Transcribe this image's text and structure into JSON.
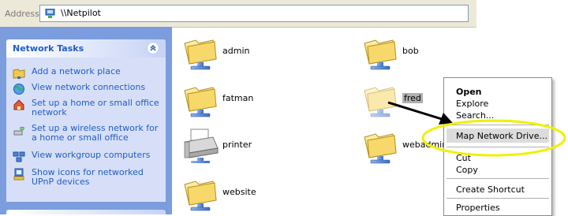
{
  "address_bar": {
    "label": "Address",
    "value": "\\\\Netpilot",
    "icon": "network-computer-icon"
  },
  "task_pane": {
    "title": "Network Tasks",
    "collapse_icon": "double-chevron-up-icon",
    "tasks": [
      {
        "label": "Add a network place",
        "icon": "network-place-icon"
      },
      {
        "label": "View network connections",
        "icon": "globe-icon"
      },
      {
        "label": "Set up a home or small office network",
        "icon": "home-network-icon"
      },
      {
        "label": "Set up a wireless network for a home or small office",
        "icon": "wireless-icon"
      },
      {
        "label": "View workgroup computers",
        "icon": "workgroup-icon"
      },
      {
        "label": "Show icons for networked UPnP devices",
        "icon": "upnp-icon"
      }
    ]
  },
  "shares": [
    {
      "name": "admin",
      "icon": "shared-folder-icon"
    },
    {
      "name": "bob",
      "icon": "shared-folder-icon"
    },
    {
      "name": "fatman",
      "icon": "shared-folder-icon"
    },
    {
      "name": "fred",
      "icon": "shared-folder-icon",
      "selected": true
    },
    {
      "name": "printer",
      "icon": "printer-icon"
    },
    {
      "name": "webadmin",
      "icon": "shared-folder-icon"
    },
    {
      "name": "website",
      "icon": "shared-folder-icon"
    }
  ],
  "context_menu": {
    "items": [
      "Open",
      "Explore",
      "Search...",
      "Map Network Drive...",
      "Cut",
      "Copy",
      "Create Shortcut",
      "Properties"
    ],
    "highlighted": "Map Network Drive..."
  },
  "colors": {
    "task_pane_bg": "#7b9ddd",
    "task_link": "#215dc6",
    "selection": "#b0b0b0",
    "annotation_circle": "#f0f000",
    "annotation_arrow": "#000000"
  }
}
